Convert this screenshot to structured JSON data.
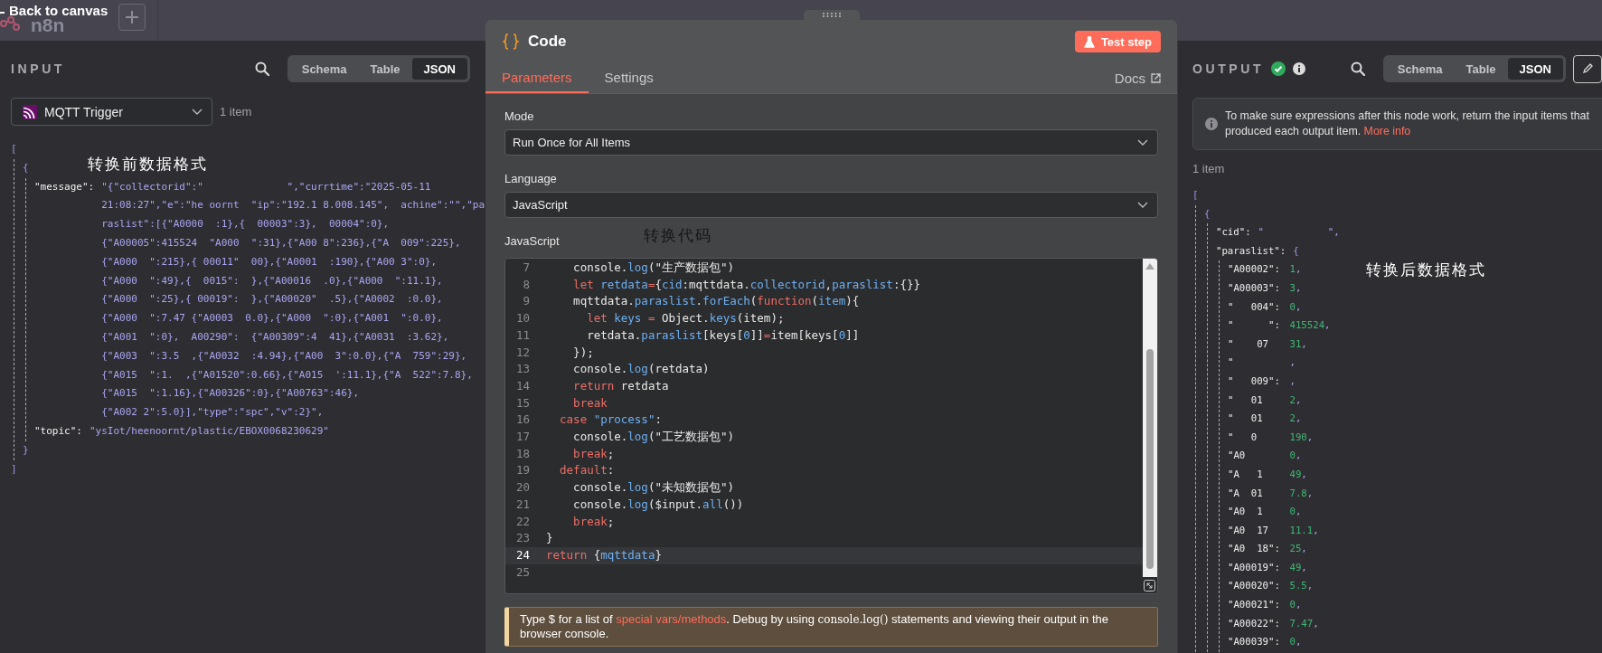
{
  "topbar": {
    "back_label": "Back to canvas",
    "logo_text": "n8n"
  },
  "input_panel": {
    "title": "INPUT",
    "views": [
      {
        "label": "Schema",
        "selected": false
      },
      {
        "label": "Table",
        "selected": false
      },
      {
        "label": "JSON",
        "selected": true
      }
    ],
    "node_select": "MQTT Trigger",
    "item_count": "1 item",
    "annotation": "转换前数据格式",
    "tree": {
      "open": "[",
      "close": "]",
      "children": [
        {
          "open": "{",
          "close": "}",
          "children": [
            {
              "key": "\"message\":",
              "kind": "string",
              "value": "\"{\"collectorid\":\"              \",\"currtime\":\"2025-05-11\n21:08:27\",\"e\":\"he oornt  \"ip\":\"192.1 8.008.145\",  achine\":\"\",\"pa\nraslist\":[{\"A0000  :1},{  00003\":3},  00004\":0},\n{\"A00005\":415524  \"A000  \":31},{\"A00 8\":236},{\"A  009\":225},\n{\"A000  \":215},{ 00011\"  00},{\"A0001  :190},{\"A00 3\":0},\n{\"A000  \":49},{  0015\":  },{\"A00016  .0},{\"A000  \":11.1},\n{\"A000  \":25},{ 00019\":  },{\"A00020\"  .5},{\"A0002  :0.0},\n{\"A000  \":7.47 {\"A0003  0.0},{\"A000  \":0},{\"A001  \":0.0},\n{\"A001  \":0},  A00290\":  {\"A00309\":4  41},{\"A0031  :3.62},\n{\"A003  \":3.5  ,{\"A0032  :4.94},{\"A00  3\":0.0},{\"A  759\":29},\n{\"A015  \":1.  ,{\"A01520\":0.66},{\"A015  ':11.1},{\"A  522\":7.8},\n{\"A015  \":1.16},{\"A00326\":0},{\"A00763\":46},\n{\"A002 2\":5.0}],\"type\":\"spc\",\"v\":2}\","
            },
            {
              "key": "\"topic\":",
              "kind": "string",
              "value": "\"ysIot/heenoornt/plastic/EBOX0068230629\""
            }
          ]
        }
      ]
    }
  },
  "code_panel": {
    "title": "Code",
    "test_button": "Test step",
    "tabs": [
      {
        "label": "Parameters",
        "selected": true
      },
      {
        "label": "Settings",
        "selected": false
      }
    ],
    "docs_link": "Docs",
    "fields": [
      {
        "label": "Mode",
        "value": "Run Once for All Items"
      },
      {
        "label": "Language",
        "value": "JavaScript"
      }
    ],
    "editor_label": "JavaScript",
    "annotation": "转换代码",
    "code_lines": [
      {
        "number": "7",
        "current": false,
        "tokens": [
          {
            "kind": "plain",
            "text": "    console."
          },
          {
            "kind": "prop",
            "text": "log"
          },
          {
            "kind": "plain",
            "text": "(\"生产数据包\")"
          }
        ]
      },
      {
        "number": "8",
        "current": false,
        "tokens": [
          {
            "kind": "keyword",
            "text": "    let"
          },
          {
            "kind": "prop",
            "text": " retdata"
          },
          {
            "kind": "keyword",
            "text": "="
          },
          {
            "kind": "plain",
            "text": "{"
          },
          {
            "kind": "prop",
            "text": "cid"
          },
          {
            "kind": "plain",
            "text": ":mqttdata."
          },
          {
            "kind": "prop",
            "text": "collectorid"
          },
          {
            "kind": "plain",
            "text": ","
          },
          {
            "kind": "prop",
            "text": "paraslist"
          },
          {
            "kind": "plain",
            "text": ":{}}"
          }
        ]
      },
      {
        "number": "9",
        "current": false,
        "tokens": [
          {
            "kind": "plain",
            "text": "    mqttdata."
          },
          {
            "kind": "prop",
            "text": "paraslist"
          },
          {
            "kind": "plain",
            "text": "."
          },
          {
            "kind": "prop",
            "text": "forEach"
          },
          {
            "kind": "plain",
            "text": "("
          },
          {
            "kind": "keyword",
            "text": "function"
          },
          {
            "kind": "plain",
            "text": "("
          },
          {
            "kind": "prop",
            "text": "item"
          },
          {
            "kind": "plain",
            "text": "){"
          }
        ]
      },
      {
        "number": "10",
        "current": false,
        "tokens": [
          {
            "kind": "keyword",
            "text": "      let"
          },
          {
            "kind": "prop",
            "text": " keys"
          },
          {
            "kind": "keyword",
            "text": " = "
          },
          {
            "kind": "plain",
            "text": "Object."
          },
          {
            "kind": "prop",
            "text": "keys"
          },
          {
            "kind": "plain",
            "text": "(item);"
          }
        ]
      },
      {
        "number": "11",
        "current": false,
        "tokens": [
          {
            "kind": "plain",
            "text": "      retdata."
          },
          {
            "kind": "prop",
            "text": "paraslist"
          },
          {
            "kind": "plain",
            "text": "[keys["
          },
          {
            "kind": "prop",
            "text": "0"
          },
          {
            "kind": "plain",
            "text": "]]"
          },
          {
            "kind": "keyword",
            "text": "="
          },
          {
            "kind": "plain",
            "text": "item[keys["
          },
          {
            "kind": "prop",
            "text": "0"
          },
          {
            "kind": "plain",
            "text": "]]"
          }
        ]
      },
      {
        "number": "12",
        "current": false,
        "tokens": [
          {
            "kind": "plain",
            "text": "    });"
          }
        ]
      },
      {
        "number": "13",
        "current": false,
        "tokens": [
          {
            "kind": "plain",
            "text": "    console."
          },
          {
            "kind": "prop",
            "text": "log"
          },
          {
            "kind": "plain",
            "text": "(retdata)"
          }
        ]
      },
      {
        "number": "14",
        "current": false,
        "tokens": [
          {
            "kind": "keyword",
            "text": "    return"
          },
          {
            "kind": "plain",
            "text": " retdata"
          }
        ]
      },
      {
        "number": "15",
        "current": false,
        "tokens": [
          {
            "kind": "keyword",
            "text": "    break"
          }
        ]
      },
      {
        "number": "16",
        "current": false,
        "tokens": [
          {
            "kind": "keyword",
            "text": "  case"
          },
          {
            "kind": "prop",
            "text": " \"process\""
          },
          {
            "kind": "plain",
            "text": ":"
          }
        ]
      },
      {
        "number": "17",
        "current": false,
        "tokens": [
          {
            "kind": "plain",
            "text": "    console."
          },
          {
            "kind": "prop",
            "text": "log"
          },
          {
            "kind": "plain",
            "text": "(\"工艺数据包\")"
          }
        ]
      },
      {
        "number": "18",
        "current": false,
        "tokens": [
          {
            "kind": "keyword",
            "text": "    break"
          },
          {
            "kind": "plain",
            "text": ";"
          }
        ]
      },
      {
        "number": "19",
        "current": false,
        "tokens": [
          {
            "kind": "keyword",
            "text": "  default"
          },
          {
            "kind": "plain",
            "text": ":"
          }
        ]
      },
      {
        "number": "20",
        "current": false,
        "tokens": [
          {
            "kind": "plain",
            "text": "    console."
          },
          {
            "kind": "prop",
            "text": "log"
          },
          {
            "kind": "plain",
            "text": "(\"未知数据包\")"
          }
        ]
      },
      {
        "number": "21",
        "current": false,
        "tokens": [
          {
            "kind": "plain",
            "text": "    console."
          },
          {
            "kind": "prop",
            "text": "log"
          },
          {
            "kind": "plain",
            "text": "($input."
          },
          {
            "kind": "prop",
            "text": "all"
          },
          {
            "kind": "plain",
            "text": "())"
          }
        ]
      },
      {
        "number": "22",
        "current": false,
        "tokens": [
          {
            "kind": "keyword",
            "text": "    break"
          },
          {
            "kind": "plain",
            "text": ";"
          }
        ]
      },
      {
        "number": "23",
        "current": false,
        "tokens": [
          {
            "kind": "plain",
            "text": "}"
          }
        ]
      },
      {
        "number": "24",
        "current": true,
        "tokens": [
          {
            "kind": "keyword",
            "text": "return"
          },
          {
            "kind": "plain",
            "text": " {"
          },
          {
            "kind": "prop",
            "text": "mqttdata"
          },
          {
            "kind": "plain",
            "text": "}"
          }
        ]
      },
      {
        "number": "25",
        "current": false
      }
    ],
    "tip": [
      {
        "kind": "text",
        "text": "Type $ for a list of "
      },
      {
        "kind": "link",
        "text": "special vars/methods"
      },
      {
        "kind": "text",
        "text": ". Debug by using "
      },
      {
        "kind": "code",
        "text": "console.log()"
      },
      {
        "kind": "text",
        "text": " statements and viewing their output in the browser console."
      }
    ]
  },
  "output_panel": {
    "title": "OUTPUT",
    "success": true,
    "info": true,
    "views": [
      {
        "label": "Schema",
        "selected": false
      },
      {
        "label": "Table",
        "selected": false
      },
      {
        "label": "JSON",
        "selected": true
      }
    ],
    "edit_button": true,
    "notice": {
      "text": "To make sure expressions after this node work, return the input items that produced each output item. ",
      "link": "More info"
    },
    "item_count": "1 item",
    "annotation": "转换后数据格式",
    "tree": {
      "open": "[",
      "children": [
        {
          "open": "{",
          "children": [
            {
              "key": "\"cid\":",
              "kind": "string",
              "value": "\"           \"",
              "punct": ","
            },
            {
              "key": "\"paraslist\":",
              "open": "{",
              "children": [
                {
                  "key": "\"A00002\":",
                  "kind": "number",
                  "value": "1",
                  "punct": ","
                },
                {
                  "key": "\"A00003\":",
                  "kind": "number",
                  "value": "3",
                  "punct": ","
                },
                {
                  "key": "\"   004\":",
                  "kind": "number",
                  "value": "0",
                  "punct": ","
                },
                {
                  "key": "\"      \":",
                  "kind": "number",
                  "value": "415524",
                  "punct": ","
                },
                {
                  "key": "\"    07",
                  "kind": "number",
                  "value": "31",
                  "punct": ","
                },
                {
                  "key": "\"",
                  "kind": "number",
                  "punct": ","
                },
                {
                  "key": "\"   009\":",
                  "kind": "number",
                  "punct": ","
                },
                {
                  "key": "\"   01",
                  "kind": "number",
                  "value": "2",
                  "punct": ","
                },
                {
                  "key": "\"   01",
                  "kind": "number",
                  "value": "2",
                  "punct": ","
                },
                {
                  "key": "\"   0",
                  "kind": "number",
                  "value": "190",
                  "punct": ","
                },
                {
                  "key": "\"A0",
                  "kind": "number",
                  "value": "0",
                  "punct": ","
                },
                {
                  "key": "\"A   1",
                  "kind": "number",
                  "value": "49",
                  "punct": ","
                },
                {
                  "key": "\"A  01",
                  "kind": "number",
                  "value": "7.8",
                  "punct": ","
                },
                {
                  "key": "\"A0  1",
                  "kind": "number",
                  "value": "0",
                  "punct": ","
                },
                {
                  "key": "\"A0  17",
                  "kind": "number",
                  "value": "11.1",
                  "punct": ","
                },
                {
                  "key": "\"A0  18\":",
                  "kind": "number",
                  "value": "25",
                  "punct": ","
                },
                {
                  "key": "\"A00019\":",
                  "kind": "number",
                  "value": "49",
                  "punct": ","
                },
                {
                  "key": "\"A00020\":",
                  "kind": "number",
                  "value": "5.5",
                  "punct": ","
                },
                {
                  "key": "\"A00021\":",
                  "kind": "number",
                  "value": "0",
                  "punct": ","
                },
                {
                  "key": "\"A00022\":",
                  "kind": "number",
                  "value": "7.47",
                  "punct": ","
                },
                {
                  "key": "\"A00039\":",
                  "kind": "number",
                  "value": "0",
                  "punct": ","
                }
              ]
            }
          ]
        }
      ]
    }
  }
}
